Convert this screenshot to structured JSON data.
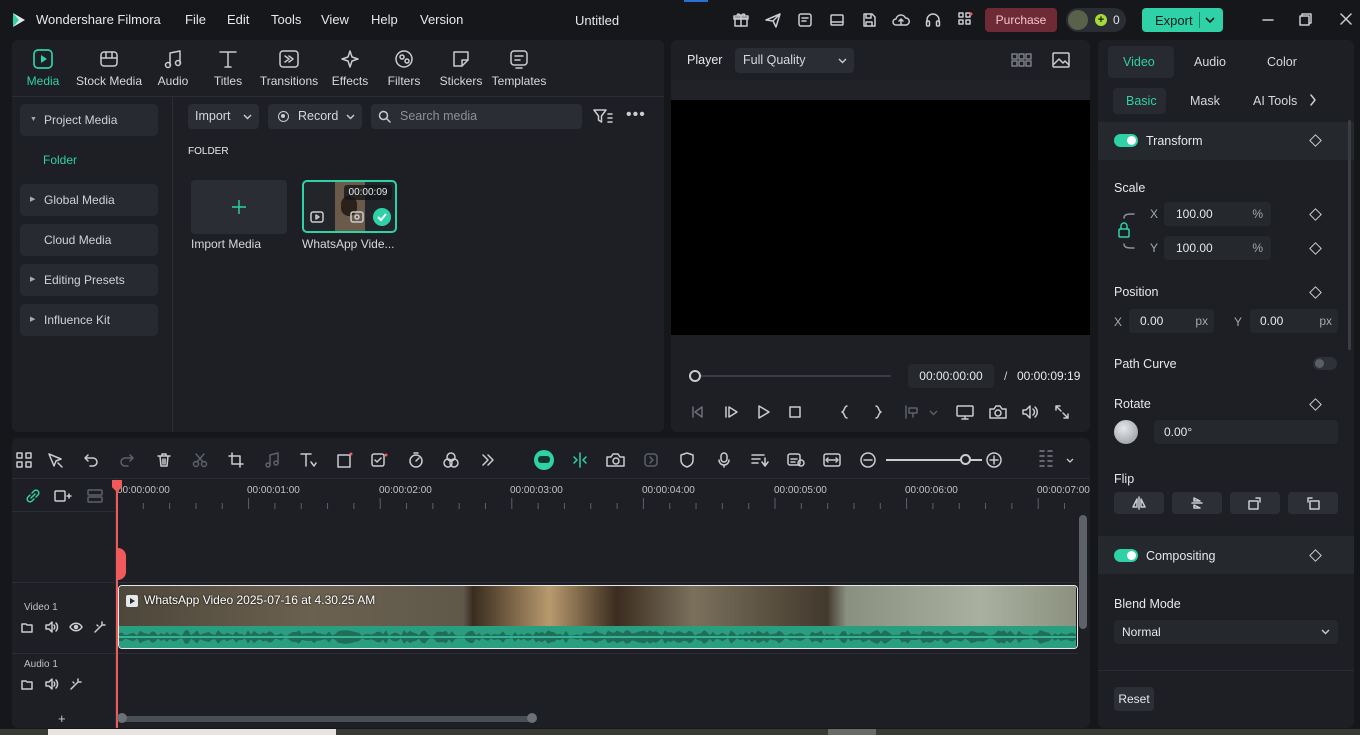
{
  "app": {
    "name": "Wondershare Filmora",
    "document_title": "Untitled"
  },
  "menu": [
    "File",
    "Edit",
    "Tools",
    "View",
    "Help",
    "Version"
  ],
  "titlebar": {
    "purchase_label": "Purchase",
    "credits": "0",
    "export_label": "Export"
  },
  "toolbar_tabs": [
    "Media",
    "Stock Media",
    "Audio",
    "Titles",
    "Transitions",
    "Effects",
    "Filters",
    "Stickers",
    "Templates"
  ],
  "sidebar": {
    "items": [
      {
        "label": "Project Media"
      },
      {
        "label": "Folder"
      },
      {
        "label": "Global Media"
      },
      {
        "label": "Cloud Media"
      },
      {
        "label": "Editing Presets"
      },
      {
        "label": "Influence Kit"
      }
    ]
  },
  "media_toolbar": {
    "import_label": "Import",
    "record_label": "Record",
    "search_placeholder": "Search media"
  },
  "folder_heading": "FOLDER",
  "media_items": [
    {
      "label": "Import Media"
    },
    {
      "label": "WhatsApp Vide...",
      "duration": "00:00:09"
    }
  ],
  "player": {
    "label": "Player",
    "quality": "Full Quality",
    "current_time": "00:00:00:00",
    "separator": "/",
    "total_time": "00:00:09:19"
  },
  "properties": {
    "tabs": [
      "Video",
      "Audio",
      "Color"
    ],
    "subtabs": [
      "Basic",
      "Mask",
      "AI Tools"
    ],
    "transform_label": "Transform",
    "scale_label": "Scale",
    "scale_x_label": "X",
    "scale_x": "100.00",
    "scale_y_label": "Y",
    "scale_y": "100.00",
    "percent": "%",
    "position_label": "Position",
    "pos_x_label": "X",
    "pos_x": "0.00",
    "pos_y_label": "Y",
    "pos_y": "0.00",
    "px": "px",
    "path_curve_label": "Path Curve",
    "rotate_label": "Rotate",
    "rotate_value": "0.00°",
    "flip_label": "Flip",
    "compositing_label": "Compositing",
    "blend_mode_label": "Blend Mode",
    "blend_mode": "Normal",
    "reset_label": "Reset"
  },
  "timeline": {
    "ruler": [
      "00:00:00:00",
      "00:00:01:00",
      "00:00:02:00",
      "00:00:03:00",
      "00:00:04:00",
      "00:00:05:00",
      "00:00:06:00",
      "00:00:07:00"
    ],
    "video_track_label": "Video 1",
    "audio_track_label": "Audio 1",
    "clip_title": "WhatsApp Video 2025-07-16 at 4.30.25 AM",
    "add_track": "+",
    "zoom_level": 0.83
  },
  "colors": {
    "accent": "#2fd1a7",
    "purchase": "#6e2b36",
    "playhead": "#f05a5a"
  }
}
